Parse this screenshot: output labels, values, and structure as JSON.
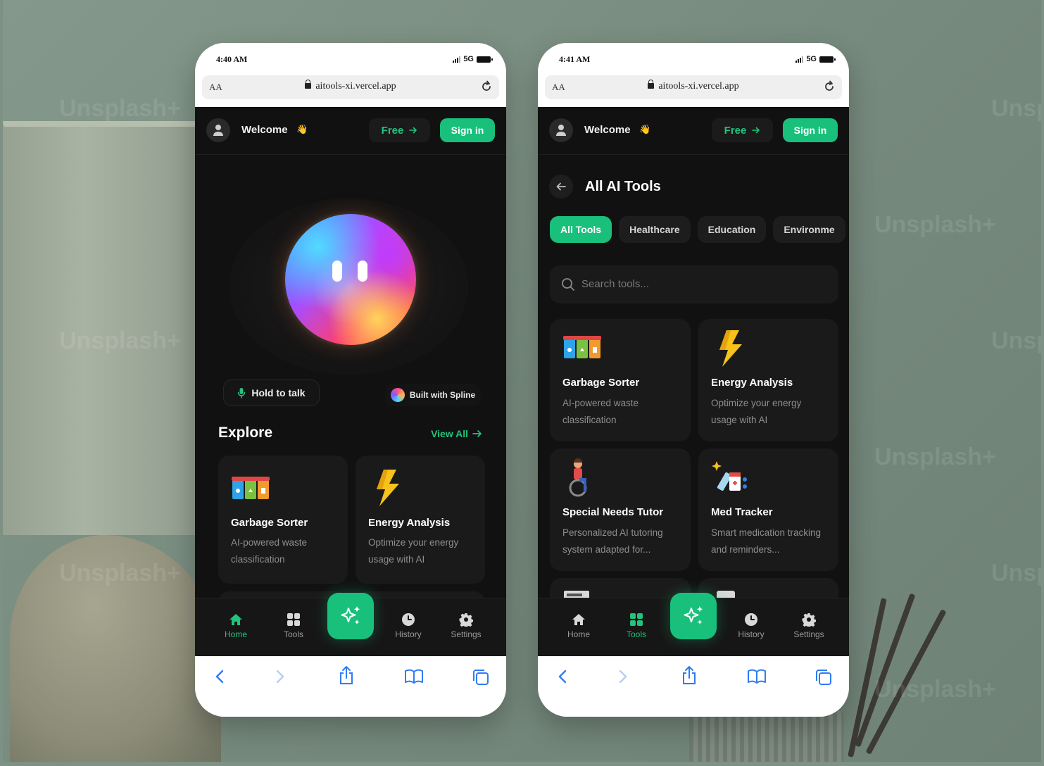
{
  "background": {
    "watermark_text": "Unsplash+"
  },
  "phone1": {
    "status": {
      "time": "4:40 AM",
      "network": "5G"
    },
    "browser": {
      "aa_label": "AA",
      "url": "aitools-xi.vercel.app"
    },
    "header": {
      "welcome": "Welcome",
      "wave_emoji": "👋",
      "free_label": "Free",
      "signin_label": "Sign in"
    },
    "hero": {
      "hold_to_talk": "Hold to talk",
      "built_with": "Built with Spline"
    },
    "explore": {
      "title": "Explore",
      "view_all": "View All"
    },
    "cards": [
      {
        "title": "Garbage Sorter",
        "desc": "AI-powered waste classification",
        "icon": "recycle-bins-icon"
      },
      {
        "title": "Energy Analysis",
        "desc": "Optimize your energy usage with AI",
        "icon": "lightning-icon"
      },
      {
        "title": "",
        "desc": "",
        "icon": "wheelchair-person-icon"
      },
      {
        "title": "",
        "desc": "",
        "icon": "medicine-icon"
      }
    ],
    "tabbar": {
      "home": "Home",
      "tools": "Tools",
      "history": "History",
      "settings": "Settings",
      "active": "home"
    }
  },
  "phone2": {
    "status": {
      "time": "4:41 AM",
      "network": "5G"
    },
    "browser": {
      "aa_label": "AA",
      "url": "aitools-xi.vercel.app"
    },
    "header": {
      "welcome": "Welcome",
      "wave_emoji": "👋",
      "free_label": "Free",
      "signin_label": "Sign in"
    },
    "page_title": "All AI Tools",
    "chips": [
      "All Tools",
      "Healthcare",
      "Education",
      "Environme"
    ],
    "active_chip": "All Tools",
    "search": {
      "placeholder": "Search tools..."
    },
    "cards": [
      {
        "title": "Garbage Sorter",
        "desc": "AI-powered waste classification",
        "icon": "recycle-bins-icon"
      },
      {
        "title": "Energy Analysis",
        "desc": "Optimize your energy usage with AI",
        "icon": "lightning-icon"
      },
      {
        "title": "Special Needs Tutor",
        "desc": "Personalized AI tutoring system adapted for...",
        "icon": "wheelchair-person-icon"
      },
      {
        "title": "Med Tracker",
        "desc": "Smart medication tracking and reminders...",
        "icon": "medicine-icon"
      }
    ],
    "tabbar": {
      "home": "Home",
      "tools": "Tools",
      "history": "History",
      "settings": "Settings",
      "active": "tools"
    }
  },
  "colors": {
    "accent": "#19c07c",
    "app_bg": "#111111",
    "card_bg": "#1a1a1a"
  }
}
